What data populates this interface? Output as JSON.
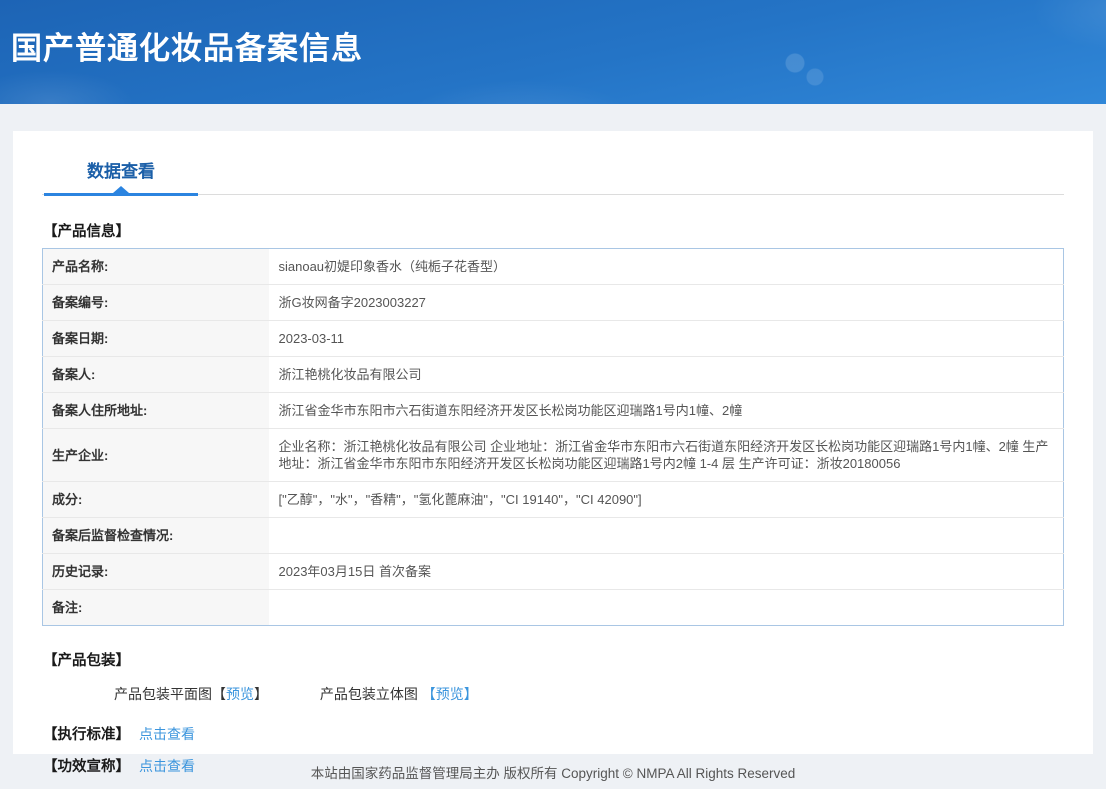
{
  "header": {
    "title": "国产普通化妆品备案信息"
  },
  "tabs": {
    "data_view": "数据查看"
  },
  "product_info": {
    "section_title": "【产品信息】",
    "rows": [
      {
        "label": "产品名称:",
        "value": "sianoau初媞印象香水（纯栀子花香型）"
      },
      {
        "label": "备案编号:",
        "value": "浙G妆网备字2023003227"
      },
      {
        "label": "备案日期:",
        "value": "2023-03-11"
      },
      {
        "label": "备案人:",
        "value": "浙江艳桃化妆品有限公司"
      },
      {
        "label": "备案人住所地址:",
        "value": "浙江省金华市东阳市六石街道东阳经济开发区长松岗功能区迎瑞路1号内1幢、2幢"
      },
      {
        "label": "生产企业:",
        "value": "企业名称：浙江艳桃化妆品有限公司 企业地址：浙江省金华市东阳市六石街道东阳经济开发区长松岗功能区迎瑞路1号内1幢、2幢 生产地址：浙江省金华市东阳市东阳经济开发区长松岗功能区迎瑞路1号内2幢 1-4 层 生产许可证：浙妆20180056"
      },
      {
        "label": "成分:",
        "value": "[\"乙醇\"，\"水\"，\"香精\"，\"氢化蓖麻油\"，\"CI 19140\"，\"CI 42090\"]"
      },
      {
        "label": "备案后监督检查情况:",
        "value": ""
      },
      {
        "label": "历史记录:",
        "value": "2023年03月15日 首次备案"
      },
      {
        "label": "备注:",
        "value": ""
      }
    ]
  },
  "packaging": {
    "section_title": "【产品包装】",
    "flat_label": "产品包装平面图",
    "flat_bracket_open": "【",
    "flat_preview": "预览",
    "flat_bracket_close": "】",
    "stereo_label": "产品包装立体图 ",
    "stereo_preview": "【预览】"
  },
  "standard": {
    "section_title": "【执行标准】",
    "link_label": "点击查看"
  },
  "efficacy": {
    "section_title": "【功效宣称】",
    "link_label": "点击查看"
  },
  "footer": {
    "text": "本站由国家药品监督管理局主办 版权所有 Copyright © NMPA All Rights Reserved"
  },
  "colors": {
    "header_gradient_start": "#1d64b5",
    "header_gradient_end": "#3087d8",
    "tab_text": "#1b5fa8",
    "tab_underline": "#2b84e0",
    "table_border": "#a9c6e4",
    "label_cell_bg": "#f7f7f7",
    "link_blue": "#3b95dd",
    "page_bg": "#eef1f5"
  }
}
